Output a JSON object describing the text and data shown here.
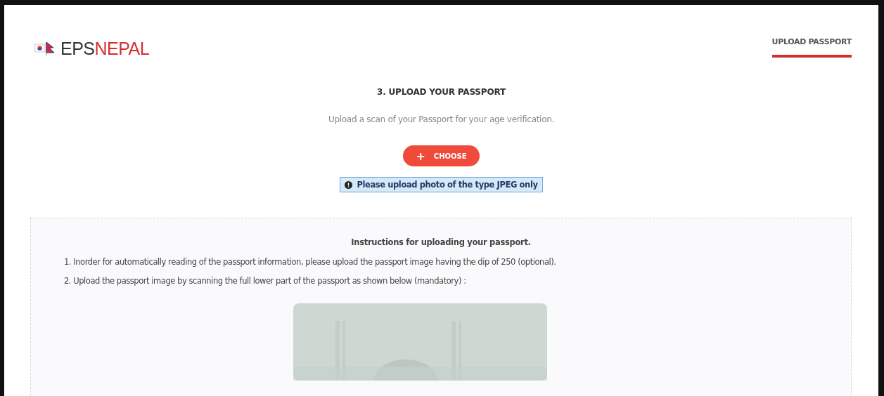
{
  "logo": {
    "dark_text": "EPS",
    "red_text": "NEPAL"
  },
  "nav": [
    {
      "label": "UPLOAD PASSPORT",
      "selected": true
    }
  ],
  "step": {
    "title": "3. UPLOAD YOUR PASSPORT",
    "subtitle": "Upload a scan of your Passport for your age verification.",
    "button": {
      "icon": "+",
      "label": "CHOOSE"
    },
    "notice": "Please upload photo of the type JPEG only"
  },
  "instructions": {
    "title": "Instructions for uploading your passport.",
    "items": [
      "1. Inorder for automatically reading of the passport information, please upload the passport image having the dip of 250 (optional).",
      "2. Upload the passport image by scanning the full lower part of the passport as shown below (mandatory) :"
    ]
  }
}
